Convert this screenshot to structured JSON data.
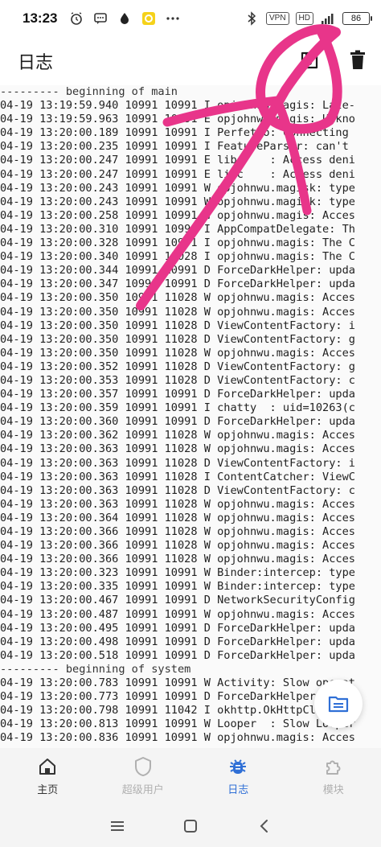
{
  "status_bar": {
    "time": "13:23",
    "left_icons": [
      "alarm-icon",
      "message-icon",
      "drop-icon",
      "app-icon",
      "more-dots-icon"
    ],
    "right_icons": [
      "bluetooth-icon",
      "vpn-badge",
      "hd-badge",
      "signal-4g-icon",
      "battery-icon"
    ],
    "vpn_label": "VPN",
    "hd_label": "HD",
    "signal_label": "4G",
    "battery_level": "86"
  },
  "app_bar": {
    "title": "日志",
    "actions": [
      "save-icon",
      "delete-icon"
    ]
  },
  "log": {
    "lines": [
      "--------- beginning of main",
      "04-19 13:19:59.940 10991 10991 I opjohnwu.magis: Late-",
      "04-19 13:19:59.963 10991 10991 E opjohnwu.magis: Unkno",
      "04-19 13:20:00.189 10991 10991 I Perfetto: Connecting",
      "04-19 13:20:00.235 10991 10991 I FeatureParser: can't",
      "04-19 13:20:00.247 10991 10991 E libc    : Access deni",
      "04-19 13:20:00.247 10991 10991 E libc    : Access deni",
      "04-19 13:20:00.243 10991 10991 W opjohnwu.magisk: type",
      "04-19 13:20:00.243 10991 10991 W opjohnwu.magisk: type",
      "04-19 13:20:00.258 10991 10991 W opjohnwu.magis: Acces",
      "04-19 13:20:00.310 10991 10991 I AppCompatDelegate: Th",
      "04-19 13:20:00.328 10991 10991 I opjohnwu.magis: The C",
      "04-19 13:20:00.340 10991 11028 I opjohnwu.magis: The C",
      "04-19 13:20:00.344 10991 10991 D ForceDarkHelper: upda",
      "04-19 13:20:00.347 10991 10991 D ForceDarkHelper: upda",
      "04-19 13:20:00.350 10991 11028 W opjohnwu.magis: Acces",
      "04-19 13:20:00.350 10991 11028 W opjohnwu.magis: Acces",
      "04-19 13:20:00.350 10991 11028 D ViewContentFactory: i",
      "04-19 13:20:00.350 10991 11028 D ViewContentFactory: g",
      "04-19 13:20:00.350 10991 11028 W opjohnwu.magis: Acces",
      "04-19 13:20:00.352 10991 11028 D ViewContentFactory: g",
      "04-19 13:20:00.353 10991 11028 D ViewContentFactory: c",
      "04-19 13:20:00.357 10991 10991 D ForceDarkHelper: upda",
      "04-19 13:20:00.359 10991 10991 I chatty  : uid=10263(c",
      "04-19 13:20:00.360 10991 10991 D ForceDarkHelper: upda",
      "04-19 13:20:00.362 10991 11028 W opjohnwu.magis: Acces",
      "04-19 13:20:00.363 10991 11028 W opjohnwu.magis: Acces",
      "04-19 13:20:00.363 10991 11028 D ViewContentFactory: i",
      "04-19 13:20:00.363 10991 11028 I ContentCatcher: ViewC",
      "04-19 13:20:00.363 10991 11028 D ViewContentFactory: c",
      "04-19 13:20:00.363 10991 11028 W opjohnwu.magis: Acces",
      "04-19 13:20:00.364 10991 11028 W opjohnwu.magis: Acces",
      "04-19 13:20:00.366 10991 11028 W opjohnwu.magis: Acces",
      "04-19 13:20:00.366 10991 11028 W opjohnwu.magis: Acces",
      "04-19 13:20:00.366 10991 11028 W opjohnwu.magis: Acces",
      "04-19 13:20:00.323 10991 10991 W Binder:intercep: type",
      "04-19 13:20:00.335 10991 10991 W Binder:intercep: type",
      "04-19 13:20:00.467 10991 10991 D NetworkSecurityConfig",
      "04-19 13:20:00.487 10991 10991 W opjohnwu.magis: Acces",
      "04-19 13:20:00.495 10991 10991 D ForceDarkHelper: upda",
      "04-19 13:20:00.498 10991 10991 D ForceDarkHelper: upda",
      "04-19 13:20:00.518 10991 10991 D ForceDarkHelper: upda",
      "--------- beginning of system",
      "04-19 13:20:00.783 10991 10991 W Activity: Slow operat",
      "04-19 13:20:00.773 10991 10991 D ForceDarkHelper: upda",
      "04-19 13:20:00.798 10991 11042 I okhttp.OkHttpClient: ",
      "04-19 13:20:00.813 10991 10991 W Looper  : Slow Looper",
      "04-19 13:20:00.836 10991 10991 W opjohnwu.magis: Acces"
    ]
  },
  "fab": {
    "icon": "folder-icon"
  },
  "bottom_nav": {
    "items": [
      {
        "label": "主页",
        "icon": "home-icon",
        "state": "normal"
      },
      {
        "label": "超级用户",
        "icon": "shield-icon",
        "state": "disabled"
      },
      {
        "label": "日志",
        "icon": "bug-icon",
        "state": "active"
      },
      {
        "label": "模块",
        "icon": "puzzle-icon",
        "state": "disabled"
      }
    ]
  },
  "system_nav": {
    "icons": [
      "menu-icon",
      "home-square-icon",
      "back-icon"
    ]
  },
  "colors": {
    "accent": "#2f6fd6",
    "annotation": "#e8358a",
    "disabled": "#b0b0b0"
  }
}
